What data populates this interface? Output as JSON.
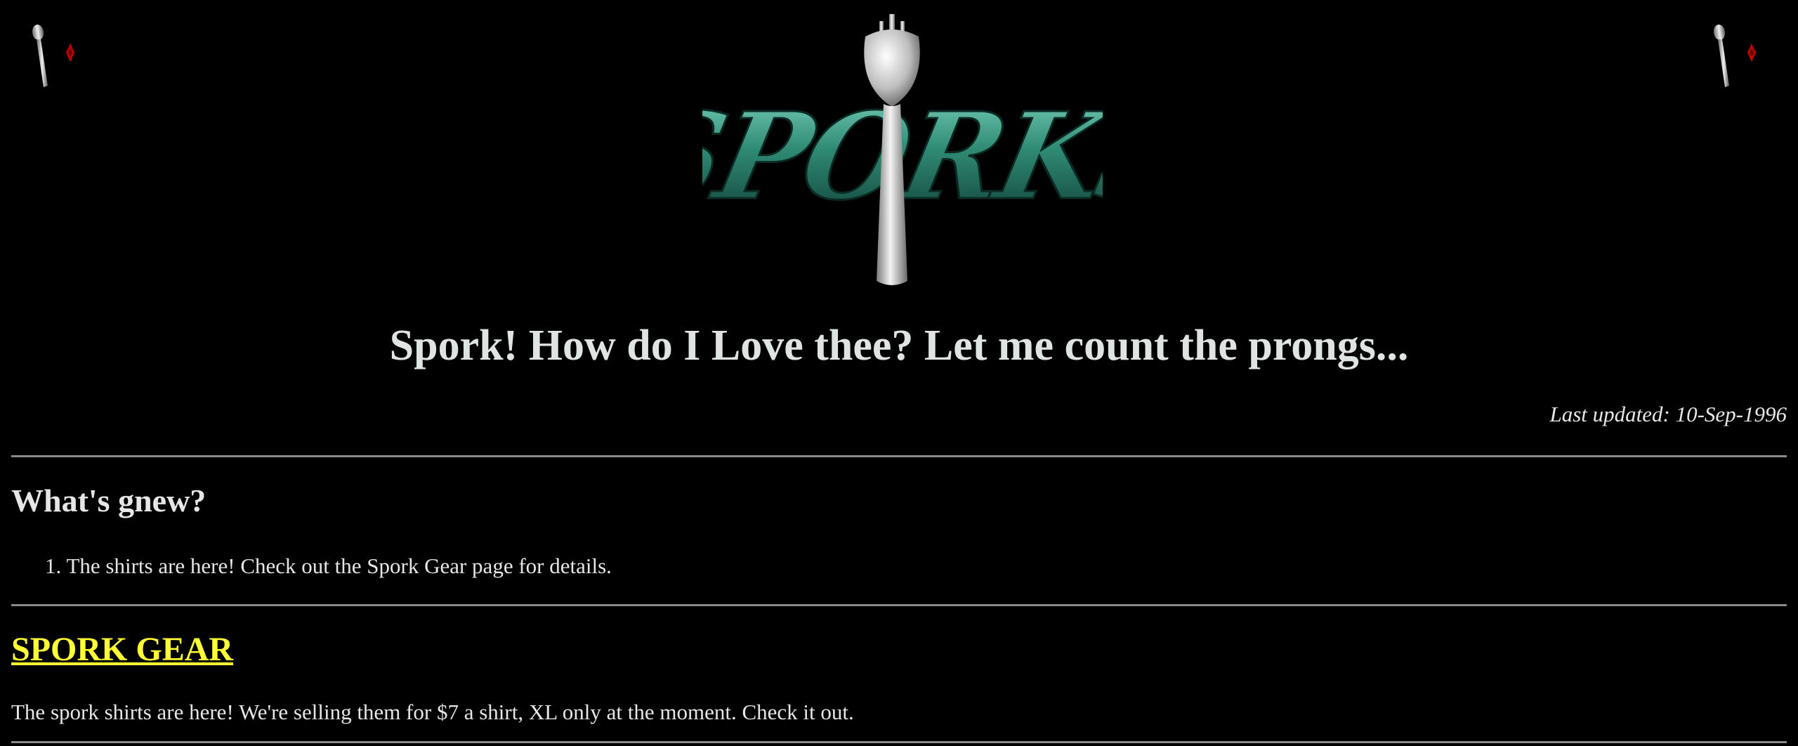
{
  "header": {
    "logo_wordmark": "SPORKS",
    "headline": "Spork! How do I Love thee? Let me count the prongs...",
    "last_updated": "Last updated: 10-Sep-1996"
  },
  "whats_new": {
    "title": "What's gnew?",
    "items": [
      {
        "number": "1.",
        "text": "The shirts are here! Check out the Spork Gear page for details."
      }
    ]
  },
  "spork_gear": {
    "link_label": "SPORK GEAR",
    "description": "The spork shirts are here! We're selling them for $7 a shirt, XL only at the moment. Check it out."
  },
  "colors": {
    "background": "#000000",
    "text": "#e6e6e6",
    "link": "#ffff33",
    "logo_teal": "#2f8a74",
    "ornament_red": "#c40000",
    "rule": "#8a8a8a"
  },
  "icons": {
    "corner": "spoon-and-diamond-icon",
    "logo": "spork-logo"
  }
}
